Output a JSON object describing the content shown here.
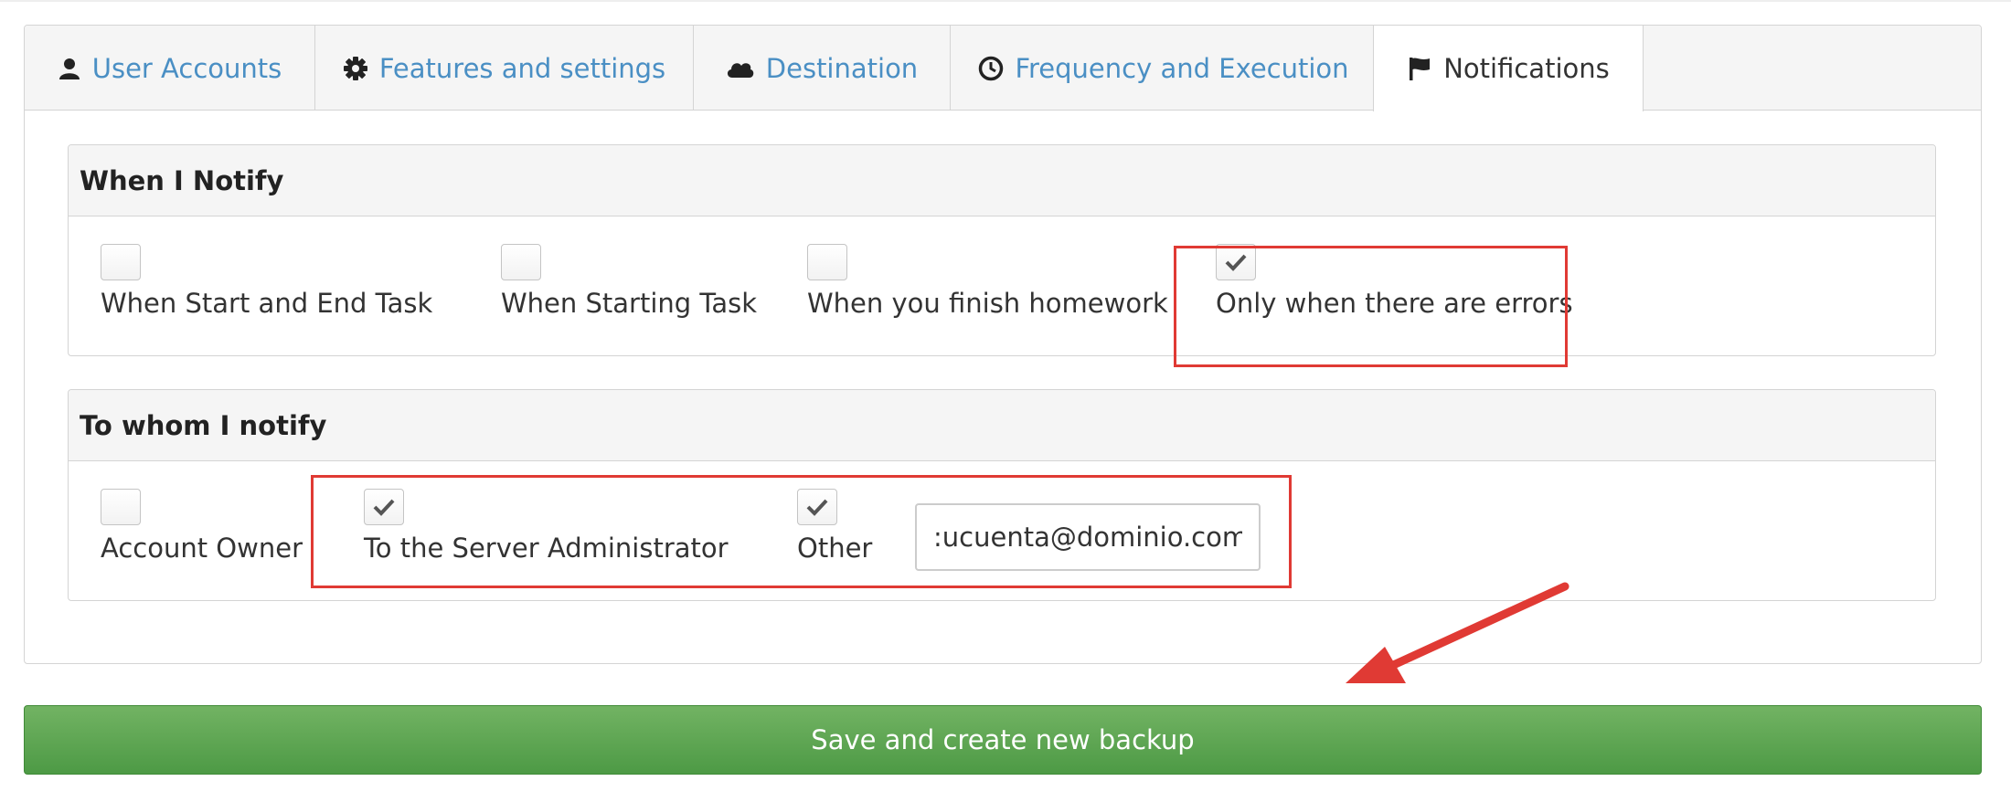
{
  "tabs": [
    {
      "label": "User Accounts",
      "icon": "user-icon"
    },
    {
      "label": "Features and settings",
      "icon": "gear-icon"
    },
    {
      "label": "Destination",
      "icon": "cloud-icon"
    },
    {
      "label": "Frequency and Execution",
      "icon": "clock-icon"
    },
    {
      "label": "Notifications",
      "icon": "flag-icon",
      "active": true
    }
  ],
  "when_notify": {
    "title": "When I Notify",
    "options": [
      {
        "label": "When Start and End Task",
        "checked": false
      },
      {
        "label": "When Starting Task",
        "checked": false
      },
      {
        "label": "When you finish homework",
        "checked": false
      },
      {
        "label": "Only when there are errors",
        "checked": true
      }
    ]
  },
  "to_whom": {
    "title": "To whom I notify",
    "options": [
      {
        "label": "Account Owner",
        "checked": false
      },
      {
        "label": "To the Server Administrator",
        "checked": true
      },
      {
        "label": "Other",
        "checked": true
      }
    ],
    "email_value": ":ucuenta@dominio.com"
  },
  "save_button": {
    "label": "Save and create new backup"
  },
  "colors": {
    "link": "#4a8fc4",
    "highlight": "#e03a34",
    "button_green": "#5ca452"
  }
}
